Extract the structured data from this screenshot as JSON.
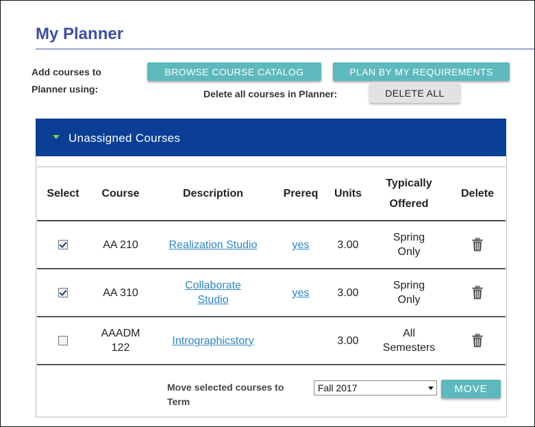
{
  "page": {
    "title": "My Planner"
  },
  "toolbar": {
    "add_label": "Add courses to Planner using:",
    "browse_label": "BROWSE COURSE CATALOG",
    "plan_label": "PLAN BY MY REQUIREMENTS",
    "delete_all_prompt": "Delete all courses in Planner:",
    "delete_all_label": "DELETE ALL"
  },
  "panel": {
    "title": "Unassigned Courses",
    "expanded": true
  },
  "table": {
    "headers": {
      "select": "Select",
      "course": "Course",
      "description": "Description",
      "prereq": "Prereq",
      "units": "Units",
      "offered_line1": "Typically",
      "offered_line2": "Offered",
      "delete": "Delete"
    },
    "rows": [
      {
        "selected": true,
        "course_line1": "AA 210",
        "course_line2": "",
        "description_line1": "Realization Studio",
        "description_line2": "",
        "prereq": "yes",
        "units": "3.00",
        "offered_line1": "Spring",
        "offered_line2": "Only"
      },
      {
        "selected": true,
        "course_line1": "AA 310",
        "course_line2": "",
        "description_line1": "Collaborate",
        "description_line2": "Studio",
        "prereq": "yes",
        "units": "3.00",
        "offered_line1": "Spring",
        "offered_line2": "Only"
      },
      {
        "selected": false,
        "course_line1": "AAADM",
        "course_line2": "122",
        "description_line1": "Intrographicstory",
        "description_line2": "",
        "prereq": "",
        "units": "3.00",
        "offered_line1": "All",
        "offered_line2": "Semesters"
      }
    ]
  },
  "move": {
    "label": "Move selected courses to Term",
    "term_value": "Fall 2017",
    "button_label": "MOVE"
  },
  "icons": {
    "expand": "triangle-down-icon",
    "delete_row": "trash-icon",
    "dropdown": "chevron-down-icon"
  },
  "colors": {
    "title": "#3e4fa5",
    "panel_header": "#0b3f95",
    "accent_button": "#5db9bd",
    "link": "#2a86c8",
    "triangle": "#7ed247"
  }
}
